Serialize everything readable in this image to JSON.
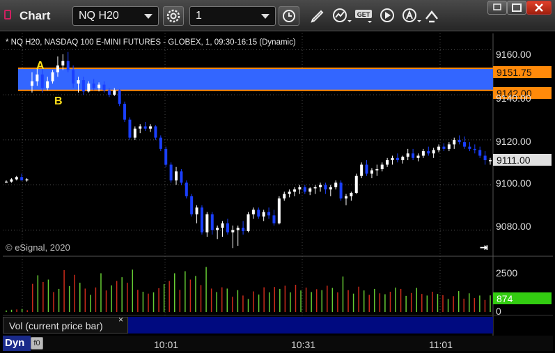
{
  "toolbar": {
    "app_title": "Chart",
    "symbol": "NQ H20",
    "interval": "1",
    "get_label": "GET",
    "icons": [
      "gear-icon",
      "clock-icon",
      "pencil-icon",
      "study-icon",
      "get-icon",
      "play-icon",
      "alert-icon",
      "link-icon"
    ]
  },
  "window": {
    "buttons": [
      "restore-icon",
      "maximize-icon",
      "close-icon"
    ]
  },
  "chart": {
    "header": "* NQ H20, NASDAQ 100 E-MINI FUTURES - GLOBEX, 1, 09:30-16:15 (Dynamic)",
    "copyright": "© eSignal, 2020",
    "markers": [
      "A",
      "B"
    ],
    "price_tags": {
      "upper": "9151.75",
      "lower": "9142.00",
      "last": "9111.00"
    },
    "volume_tag": "874",
    "volume_label": "Vol (current price bar)",
    "volume_close": "×",
    "dyn_label": "Dyn",
    "dyn_icon": "f0",
    "colors": {
      "up": "#ffffff",
      "down": "#1a3fff",
      "zone": "#3366ff",
      "zone_line": "#ff8a0a",
      "vol_up": "#66cc33",
      "vol_down": "#cc2a1a"
    }
  },
  "chart_data": {
    "type": "candlestick",
    "yticks": [
      "9160.00",
      "9140.00",
      "9120.00",
      "9100.00",
      "9080.00"
    ],
    "ylim": [
      9069,
      9166
    ],
    "zone": [
      9142.0,
      9151.75
    ],
    "xticks": [
      "10:01",
      "10:31",
      "11:01"
    ],
    "volume_ticks": [
      "2500",
      "0"
    ],
    "volume_ylim": [
      0,
      3000
    ],
    "candles": [
      [
        9101.5,
        9102.0,
        9101.0,
        9101.5
      ],
      [
        9101.5,
        9103.0,
        9101.0,
        9102.5
      ],
      [
        9102.5,
        9104.0,
        9102.0,
        9103.5
      ],
      [
        9103.5,
        9105.0,
        9102.0,
        9102.0
      ],
      [
        9102.0,
        9103.0,
        9101.5,
        9102.5
      ],
      [
        9144.0,
        9150.0,
        9141.0,
        9146.0
      ],
      [
        9146.0,
        9152.0,
        9144.0,
        9149.0
      ],
      [
        9149.0,
        9152.0,
        9141.0,
        9143.0
      ],
      [
        9143.0,
        9148.0,
        9142.0,
        9146.0
      ],
      [
        9146.0,
        9151.0,
        9145.0,
        9150.0
      ],
      [
        9150.0,
        9157.0,
        9148.0,
        9153.0
      ],
      [
        9153.0,
        9158.0,
        9151.0,
        9155.0
      ],
      [
        9155.0,
        9159.0,
        9150.0,
        9151.0
      ],
      [
        9151.0,
        9153.0,
        9143.0,
        9145.0
      ],
      [
        9145.0,
        9148.0,
        9141.0,
        9146.5
      ],
      [
        9146.5,
        9148.0,
        9140.0,
        9141.5
      ],
      [
        9141.5,
        9146.0,
        9141.0,
        9145.0
      ],
      [
        9145.0,
        9147.0,
        9142.0,
        9143.0
      ],
      [
        9143.0,
        9145.5,
        9141.5,
        9144.5
      ],
      [
        9144.5,
        9146.0,
        9141.0,
        9142.0
      ],
      [
        9142.0,
        9143.0,
        9139.0,
        9140.0
      ],
      [
        9140.0,
        9143.0,
        9139.5,
        9142.0
      ],
      [
        9142.0,
        9142.5,
        9135.0,
        9136.0
      ],
      [
        9136.0,
        9137.0,
        9128.0,
        9129.0
      ],
      [
        9129.0,
        9130.0,
        9120.0,
        9121.0
      ],
      [
        9121.0,
        9126.0,
        9120.0,
        9125.0
      ],
      [
        9125.0,
        9127.0,
        9123.0,
        9126.0
      ],
      [
        9126.0,
        9128.0,
        9124.0,
        9125.0
      ],
      [
        9125.0,
        9127.0,
        9123.5,
        9126.0
      ],
      [
        9126.0,
        9126.5,
        9120.0,
        9121.0
      ],
      [
        9121.0,
        9122.0,
        9115.0,
        9116.0
      ],
      [
        9116.0,
        9117.0,
        9108.0,
        9109.0
      ],
      [
        9109.0,
        9110.0,
        9101.0,
        9102.0
      ],
      [
        9102.0,
        9108.0,
        9100.0,
        9106.0
      ],
      [
        9106.0,
        9107.0,
        9100.0,
        9101.0
      ],
      [
        9101.0,
        9102.0,
        9094.0,
        9095.0
      ],
      [
        9095.0,
        9096.0,
        9086.0,
        9087.0
      ],
      [
        9087.0,
        9091.0,
        9083.0,
        9090.0
      ],
      [
        9090.0,
        9091.0,
        9078.0,
        9079.0
      ],
      [
        9079.0,
        9088.0,
        9077.0,
        9087.0
      ],
      [
        9087.0,
        9088.0,
        9078.0,
        9080.0
      ],
      [
        9080.0,
        9082.0,
        9076.0,
        9081.0
      ],
      [
        9081.0,
        9084.0,
        9077.0,
        9083.0
      ],
      [
        9083.0,
        9085.0,
        9078.0,
        9079.0
      ],
      [
        9079.0,
        9082.0,
        9072.0,
        9080.0
      ],
      [
        9080.0,
        9082.0,
        9073.0,
        9081.0
      ],
      [
        9081.0,
        9084.0,
        9078.0,
        9079.5
      ],
      [
        9079.5,
        9088.0,
        9079.0,
        9087.0
      ],
      [
        9087.0,
        9090.0,
        9085.0,
        9089.0
      ],
      [
        9089.0,
        9090.0,
        9085.0,
        9086.0
      ],
      [
        9086.0,
        9089.0,
        9084.0,
        9088.0
      ],
      [
        9088.0,
        9090.0,
        9085.0,
        9086.5
      ],
      [
        9086.5,
        9089.0,
        9082.0,
        9083.0
      ],
      [
        9083.0,
        9095.0,
        9082.5,
        9094.0
      ],
      [
        9094.0,
        9097.0,
        9093.0,
        9096.0
      ],
      [
        9096.0,
        9098.0,
        9094.5,
        9097.0
      ],
      [
        9097.0,
        9099.0,
        9095.0,
        9098.0
      ],
      [
        9098.0,
        9100.0,
        9096.0,
        9099.0
      ],
      [
        9099.0,
        9100.0,
        9096.0,
        9097.0
      ],
      [
        9097.0,
        9099.0,
        9095.5,
        9098.5
      ],
      [
        9098.5,
        9100.0,
        9096.0,
        9099.0
      ],
      [
        9099.0,
        9101.0,
        9097.0,
        9100.0
      ],
      [
        9100.0,
        9101.0,
        9096.0,
        9098.0
      ],
      [
        9098.0,
        9100.0,
        9095.0,
        9099.0
      ],
      [
        9099.0,
        9102.0,
        9098.0,
        9101.0
      ],
      [
        9101.0,
        9102.0,
        9093.0,
        9094.0
      ],
      [
        9094.0,
        9096.0,
        9091.0,
        9095.0
      ],
      [
        9095.0,
        9097.0,
        9093.0,
        9096.5
      ],
      [
        9096.5,
        9105.0,
        9096.0,
        9104.0
      ],
      [
        9104.0,
        9110.0,
        9103.0,
        9109.0
      ],
      [
        9109.0,
        9111.0,
        9104.0,
        9105.0
      ],
      [
        9105.0,
        9107.5,
        9103.0,
        9106.5
      ],
      [
        9106.5,
        9109.0,
        9104.0,
        9107.0
      ],
      [
        9107.0,
        9110.0,
        9106.0,
        9109.0
      ],
      [
        9109.0,
        9112.0,
        9108.0,
        9111.0
      ],
      [
        9111.0,
        9113.0,
        9109.0,
        9112.0
      ],
      [
        9112.0,
        9114.0,
        9110.0,
        9111.0
      ],
      [
        9111.0,
        9113.0,
        9109.5,
        9112.5
      ],
      [
        9112.5,
        9116.0,
        9111.0,
        9114.0
      ],
      [
        9114.0,
        9116.0,
        9111.0,
        9112.0
      ],
      [
        9112.0,
        9114.0,
        9110.5,
        9113.0
      ],
      [
        9113.0,
        9116.0,
        9112.0,
        9115.0
      ],
      [
        9115.0,
        9117.0,
        9113.0,
        9114.0
      ],
      [
        9114.0,
        9116.5,
        9112.0,
        9115.5
      ],
      [
        9115.5,
        9118.0,
        9114.5,
        9117.0
      ],
      [
        9117.0,
        9118.5,
        9115.0,
        9116.0
      ],
      [
        9116.0,
        9119.0,
        9115.0,
        9118.0
      ],
      [
        9118.0,
        9121.0,
        9116.0,
        9120.0
      ],
      [
        9120.0,
        9122.0,
        9118.0,
        9119.0
      ],
      [
        9119.0,
        9121.5,
        9116.0,
        9117.0
      ],
      [
        9117.0,
        9119.0,
        9115.0,
        9116.0
      ],
      [
        9116.0,
        9118.0,
        9114.0,
        9115.5
      ],
      [
        9115.5,
        9117.0,
        9112.0,
        9113.0
      ],
      [
        9113.0,
        9115.0,
        9109.0,
        9111.0
      ],
      [
        9111.0,
        9112.0,
        9109.0,
        9111.0
      ]
    ],
    "volume": [
      [
        90,
        1
      ],
      [
        140,
        1
      ],
      [
        160,
        0
      ],
      [
        190,
        1
      ],
      [
        110,
        0
      ],
      [
        1780,
        0
      ],
      [
        2320,
        1
      ],
      [
        1900,
        0
      ],
      [
        2050,
        1
      ],
      [
        1260,
        0
      ],
      [
        1460,
        1
      ],
      [
        2650,
        0
      ],
      [
        1640,
        1
      ],
      [
        2350,
        0
      ],
      [
        1850,
        1
      ],
      [
        1480,
        0
      ],
      [
        1080,
        1
      ],
      [
        1550,
        0
      ],
      [
        2450,
        1
      ],
      [
        1360,
        0
      ],
      [
        1680,
        1
      ],
      [
        1960,
        0
      ],
      [
        2200,
        1
      ],
      [
        1850,
        0
      ],
      [
        2680,
        1
      ],
      [
        1400,
        0
      ],
      [
        1280,
        1
      ],
      [
        1160,
        0
      ],
      [
        1240,
        1
      ],
      [
        1500,
        0
      ],
      [
        1760,
        1
      ],
      [
        1960,
        0
      ],
      [
        2450,
        1
      ],
      [
        1400,
        0
      ],
      [
        2580,
        1
      ],
      [
        2050,
        0
      ],
      [
        2280,
        1
      ],
      [
        1700,
        0
      ],
      [
        2850,
        1
      ],
      [
        1480,
        0
      ],
      [
        1260,
        1
      ],
      [
        1560,
        0
      ],
      [
        1480,
        1
      ],
      [
        960,
        0
      ],
      [
        1380,
        1
      ],
      [
        1040,
        0
      ],
      [
        820,
        1
      ],
      [
        1300,
        0
      ],
      [
        1100,
        1
      ],
      [
        1560,
        0
      ],
      [
        1240,
        1
      ],
      [
        1580,
        0
      ],
      [
        1460,
        1
      ],
      [
        1660,
        0
      ],
      [
        1240,
        1
      ],
      [
        1720,
        0
      ],
      [
        1360,
        1
      ],
      [
        1540,
        0
      ],
      [
        1260,
        1
      ],
      [
        1440,
        0
      ],
      [
        1380,
        1
      ],
      [
        1660,
        0
      ],
      [
        1520,
        1
      ],
      [
        1240,
        0
      ],
      [
        2240,
        1
      ],
      [
        1380,
        0
      ],
      [
        1160,
        1
      ],
      [
        1600,
        0
      ],
      [
        1360,
        1
      ],
      [
        1080,
        0
      ],
      [
        1460,
        1
      ],
      [
        1180,
        0
      ],
      [
        1120,
        1
      ],
      [
        1280,
        0
      ],
      [
        1540,
        1
      ],
      [
        1460,
        0
      ],
      [
        1020,
        1
      ],
      [
        1200,
        0
      ],
      [
        1520,
        1
      ],
      [
        1140,
        0
      ],
      [
        1040,
        1
      ],
      [
        1280,
        0
      ],
      [
        1140,
        1
      ],
      [
        1060,
        0
      ],
      [
        820,
        1
      ],
      [
        1000,
        0
      ],
      [
        1320,
        1
      ],
      [
        840,
        0
      ],
      [
        1180,
        1
      ],
      [
        880,
        0
      ],
      [
        1040,
        1
      ],
      [
        760,
        0
      ],
      [
        1050,
        1
      ]
    ]
  }
}
